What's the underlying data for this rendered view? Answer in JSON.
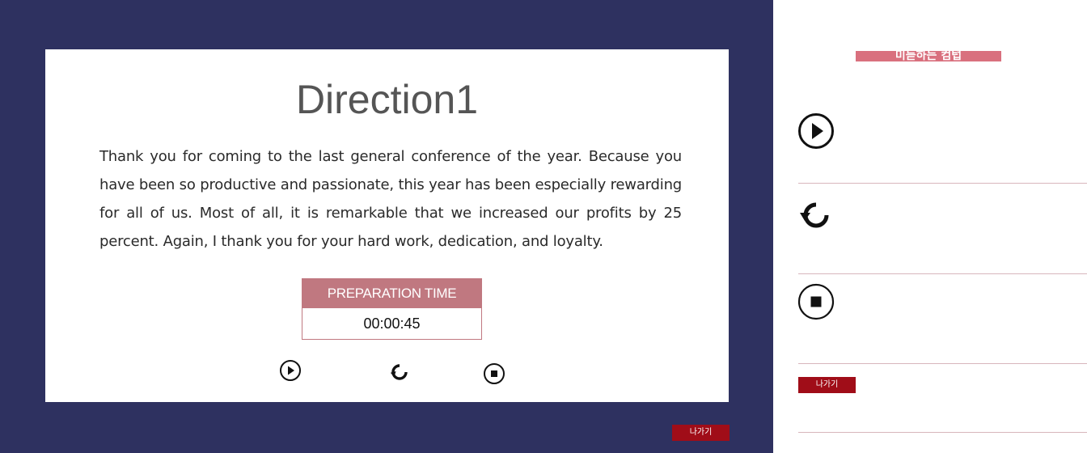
{
  "main": {
    "title": "Direction1",
    "body": "Thank you for coming to the last general conference of the year. Because you have been so productive and passionate, this year has been especially rewarding for all of us. Most of all, it is remarkable that we increased our profits by 25 percent. Again, I thank you for your hard work, dedication, and loyalty.",
    "prep_label": "PREPARATION TIME",
    "prep_time": "00:00:45",
    "exit_label": "나가기"
  },
  "side": {
    "heading": "미듣하는 컴텁",
    "exit_label": "나가기"
  },
  "icons": {
    "play": "play-circle-icon",
    "replay": "replay-icon",
    "stop": "stop-circle-icon"
  },
  "colors": {
    "background": "#2e3160",
    "accent": "#c07880",
    "exit": "#a00d18",
    "heading": "#d9707e"
  }
}
